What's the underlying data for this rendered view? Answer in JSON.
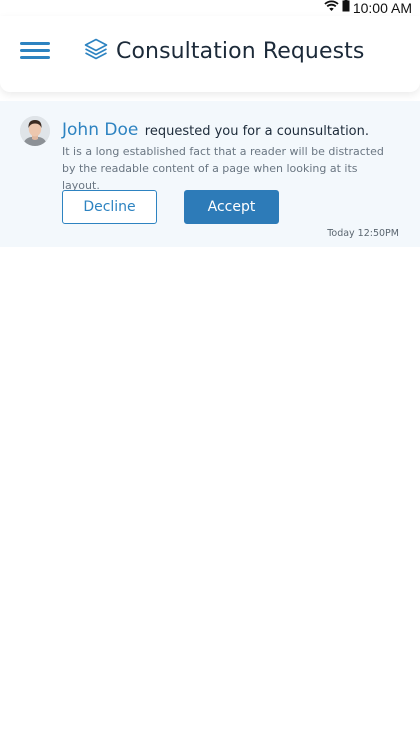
{
  "status_bar": {
    "time": "10:00 AM",
    "icons": [
      "wifi-icon",
      "battery-icon"
    ]
  },
  "header": {
    "title": "Consultation Requests",
    "icons": [
      "menu-icon",
      "layers-icon"
    ]
  },
  "notification": {
    "user_name": "John Doe",
    "action_text": "requested you for a counsultation.",
    "description": "It is a long established fact that a reader will be distracted by the readable content of a page when looking at its layout.",
    "decline_label": "Decline",
    "accept_label": "Accept",
    "timestamp": "Today 12:50PM"
  },
  "colors": {
    "accent": "#2d83c1",
    "notification_bg": "#f3f8fc",
    "accept_bg": "#2d7bb8"
  }
}
